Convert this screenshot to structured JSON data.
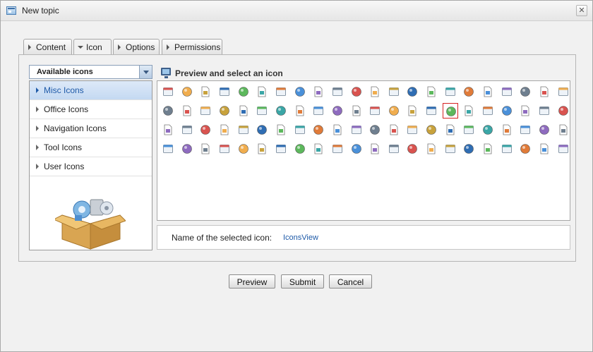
{
  "window": {
    "title": "New topic",
    "close_glyph": "✕"
  },
  "tabs": [
    {
      "label": "Content",
      "active": false
    },
    {
      "label": "Icon",
      "active": true
    },
    {
      "label": "Options",
      "active": false
    },
    {
      "label": "Permissions",
      "active": false
    }
  ],
  "category_select": {
    "value": "Available icons"
  },
  "categories": [
    {
      "label": "Misc Icons",
      "selected": true
    },
    {
      "label": "Office Icons",
      "selected": false
    },
    {
      "label": "Navigation Icons",
      "selected": false
    },
    {
      "label": "Tool Icons",
      "selected": false
    },
    {
      "label": "User Icons",
      "selected": false
    }
  ],
  "preview": {
    "title": "Preview and select an icon"
  },
  "icons": [
    [
      "pdf-doc-icon",
      "user-badge-icon",
      "tags-icon",
      "window-blue-icon",
      "window-titlebar-icon",
      "link-window-icon",
      "list-window-icon",
      "side-window-icon",
      "console-icon",
      "dome-icon",
      "info-icon",
      "bomb-icon",
      "bookmark-icon",
      "chain-link-icon",
      "cube-icon",
      "notebook-icon",
      "arrow-folder-icon",
      "check-doc-icon",
      "speech-bubble-icon",
      "settings-window-icon",
      "monitor-icon",
      "css-badge-icon"
    ],
    [
      "printer-icon",
      "download-icon",
      "green-check-icon",
      "lightning-doc-icon",
      "puzzle-icon",
      "factory-icon",
      "book-icon",
      "flash-icon",
      "stop-doc-icon",
      "folder-image-icon",
      "font-doc-icon",
      "hand-icon",
      "home-icon",
      "html-badge-icon",
      "hammer-icon",
      "calendar-grid-icon",
      "layers-red-icon",
      "windows-stack-icon",
      "document-yellow-icon",
      "window-move-icon",
      "windows-blue-icon",
      "info-circle-icon"
    ],
    [
      "grid-window-icon",
      "panel-icon",
      "frame-icon",
      "link-icon",
      "padlock-icon",
      "red-card-icon",
      "magnet-icon",
      "list-window-icon",
      "new-badge-icon",
      "copy-icon",
      "pages-icon",
      "search-doc-icon",
      "printer-icon",
      "film-icon",
      "calendar-icon",
      "rainbow-icon",
      "refresh-icon",
      "rss-badge-icon",
      "rss-icon",
      "group-icon",
      "shield-icon",
      "paint-icon"
    ],
    [
      "volume-icon",
      "volume-low-icon",
      "star-award-icon",
      "star-folder-icon",
      "bar-chart-icon",
      "eye-icon",
      "tag-yellow-icon",
      "tablet-icon",
      "text-icon",
      "linux-icon",
      "branch-icon",
      "cd-icon",
      "card-icon",
      "cloud-icon",
      "partly-sunny-icon",
      "storm-icon",
      "rain-icon",
      "snow-icon",
      "sun-icon",
      "globe-icon",
      "xhtml-badge-icon",
      "star-icon"
    ]
  ],
  "selected_icon": {
    "label": "Name of the selected icon:",
    "value": "IconsView"
  },
  "buttons": {
    "preview": "Preview",
    "submit": "Submit",
    "cancel": "Cancel"
  },
  "colors": {
    "accent": "#1e5aa8",
    "selection_border": "#d62222"
  }
}
